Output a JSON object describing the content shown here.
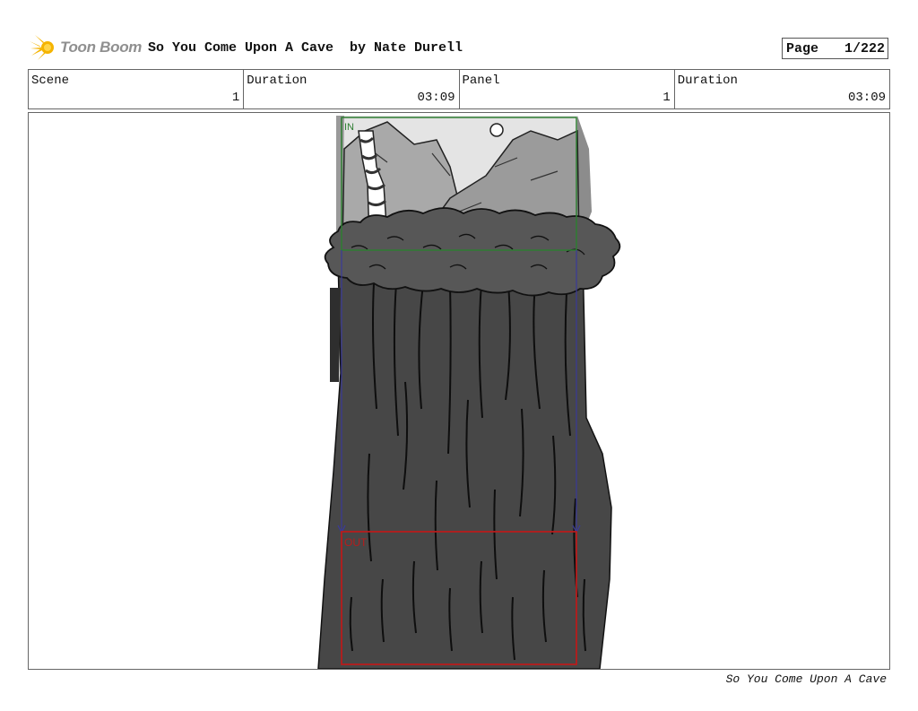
{
  "header": {
    "logo_text": "Toon Boom",
    "title": "So You Come Upon A Cave  by Nate Durell",
    "page_label": "Page",
    "page_value": "1/222"
  },
  "info": {
    "scene_label": "Scene",
    "scene_value": "1",
    "scene_duration_label": "Duration",
    "scene_duration_value": "03:09",
    "panel_label": "Panel",
    "panel_value": "1",
    "panel_duration_label": "Duration",
    "panel_duration_value": "03:09"
  },
  "panel": {
    "camera_in_label": "IN",
    "camera_out_label": "OUT",
    "camera_in_color": "#2e7d32",
    "camera_out_color": "#b71c1c",
    "camera_path_color": "#3a3a9a"
  },
  "footer": {
    "text": "So You Come Upon A Cave"
  }
}
